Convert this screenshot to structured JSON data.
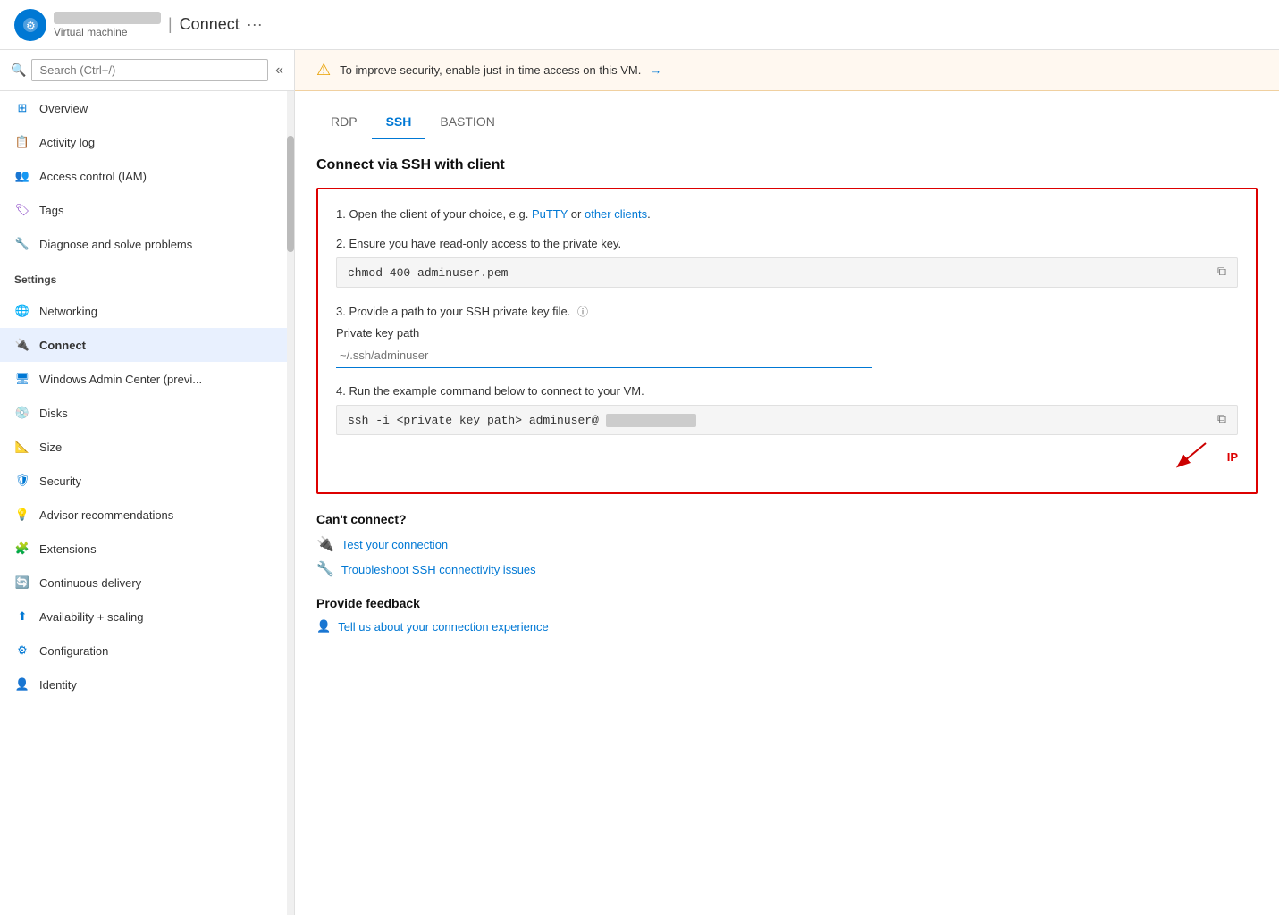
{
  "topbar": {
    "title": "Connect",
    "subtitle": "Virtual machine",
    "dots_label": "···"
  },
  "sidebar": {
    "search_placeholder": "Search (Ctrl+/)",
    "collapse_icon": "«",
    "items": [
      {
        "id": "overview",
        "label": "Overview",
        "icon": "grid-icon"
      },
      {
        "id": "activity-log",
        "label": "Activity log",
        "icon": "list-icon"
      },
      {
        "id": "access-control",
        "label": "Access control (IAM)",
        "icon": "people-icon"
      },
      {
        "id": "tags",
        "label": "Tags",
        "icon": "tag-icon"
      },
      {
        "id": "diagnose",
        "label": "Diagnose and solve problems",
        "icon": "wrench-icon"
      }
    ],
    "settings_label": "Settings",
    "settings_items": [
      {
        "id": "networking",
        "label": "Networking",
        "icon": "network-icon"
      },
      {
        "id": "connect",
        "label": "Connect",
        "icon": "connect-icon",
        "active": true
      },
      {
        "id": "windows-admin",
        "label": "Windows Admin Center (previ...",
        "icon": "admin-icon"
      },
      {
        "id": "disks",
        "label": "Disks",
        "icon": "disks-icon"
      },
      {
        "id": "size",
        "label": "Size",
        "icon": "size-icon"
      },
      {
        "id": "security",
        "label": "Security",
        "icon": "security-icon"
      },
      {
        "id": "advisor",
        "label": "Advisor recommendations",
        "icon": "advisor-icon"
      },
      {
        "id": "extensions",
        "label": "Extensions",
        "icon": "extensions-icon"
      },
      {
        "id": "continuous-delivery",
        "label": "Continuous delivery",
        "icon": "delivery-icon"
      },
      {
        "id": "availability",
        "label": "Availability + scaling",
        "icon": "availability-icon"
      },
      {
        "id": "configuration",
        "label": "Configuration",
        "icon": "config-icon"
      },
      {
        "id": "identity",
        "label": "Identity",
        "icon": "identity-icon"
      }
    ]
  },
  "warning": {
    "text": "To improve security, enable just-in-time access on this VM.",
    "arrow": "→"
  },
  "tabs": [
    {
      "id": "rdp",
      "label": "RDP",
      "active": false
    },
    {
      "id": "ssh",
      "label": "SSH",
      "active": true
    },
    {
      "id": "bastion",
      "label": "BASTION",
      "active": false
    }
  ],
  "content": {
    "heading": "Connect via SSH with client",
    "step1": {
      "text": "1. Open the client of your choice, e.g. ",
      "link1": "PuTTY",
      "or": " or ",
      "link2": "other clients",
      "period": "."
    },
    "step2": {
      "text": "2. Ensure you have read-only access to the private key.",
      "code": "chmod 400 adminuser.pem"
    },
    "step3": {
      "text": "3. Provide a path to your SSH private key file.",
      "label": "Private key path",
      "placeholder": "~/.ssh/adminuser"
    },
    "step4": {
      "text": "4. Run the example command below to connect to your VM.",
      "code_prefix": "ssh -i <private key path> adminuser@",
      "code_blurred": "██████████████",
      "ip_label": "IP"
    },
    "cant_connect": {
      "heading": "Can't connect?",
      "links": [
        {
          "id": "test-connection",
          "label": "Test your connection"
        },
        {
          "id": "troubleshoot-ssh",
          "label": "Troubleshoot SSH connectivity issues"
        }
      ]
    },
    "feedback": {
      "heading": "Provide feedback",
      "link_label": "Tell us about your connection experience"
    }
  }
}
